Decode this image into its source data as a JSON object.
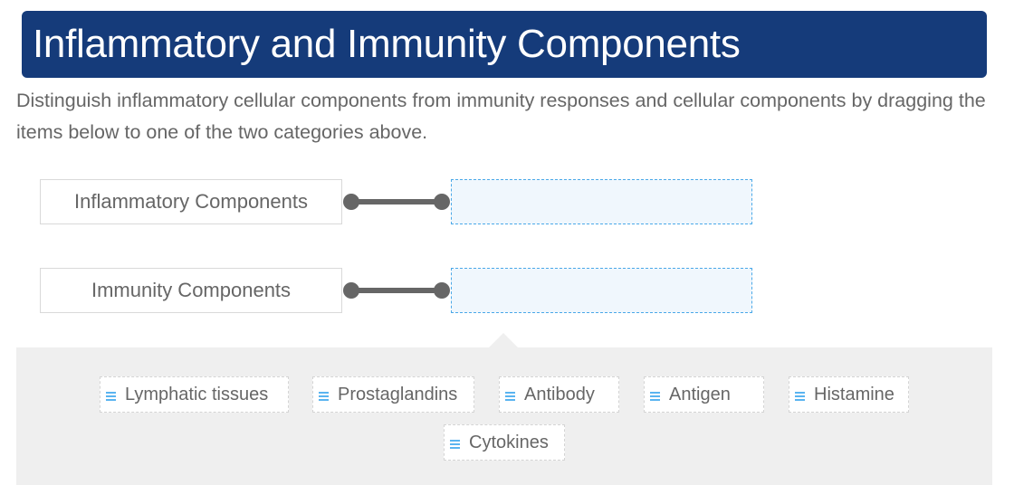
{
  "header": {
    "title": "Inflammatory and Immunity Components"
  },
  "instructions": "Distinguish inflammatory cellular components from immunity responses and cellular components by dragging the items below to one of the two categories above.",
  "categories": [
    {
      "label": "Inflammatory Components"
    },
    {
      "label": "Immunity Components"
    }
  ],
  "drag_items": [
    {
      "label": "Lymphatic tissues",
      "icon": "drag-handle-icon"
    },
    {
      "label": "Prostaglandins",
      "icon": "drag-handle-icon"
    },
    {
      "label": "Antibody",
      "icon": "drag-handle-icon"
    },
    {
      "label": "Antigen",
      "icon": "drag-handle-icon"
    },
    {
      "label": "Histamine",
      "icon": "drag-handle-icon"
    },
    {
      "label": "Cytokines",
      "icon": "drag-handle-icon"
    }
  ],
  "colors": {
    "header_bg": "#153b7a",
    "drop_zone_border": "#4aa8e8",
    "drop_zone_bg": "#f0f7fd",
    "drag_handle": "#5ab4f0",
    "tray_bg": "#efefef",
    "text": "#666666"
  }
}
